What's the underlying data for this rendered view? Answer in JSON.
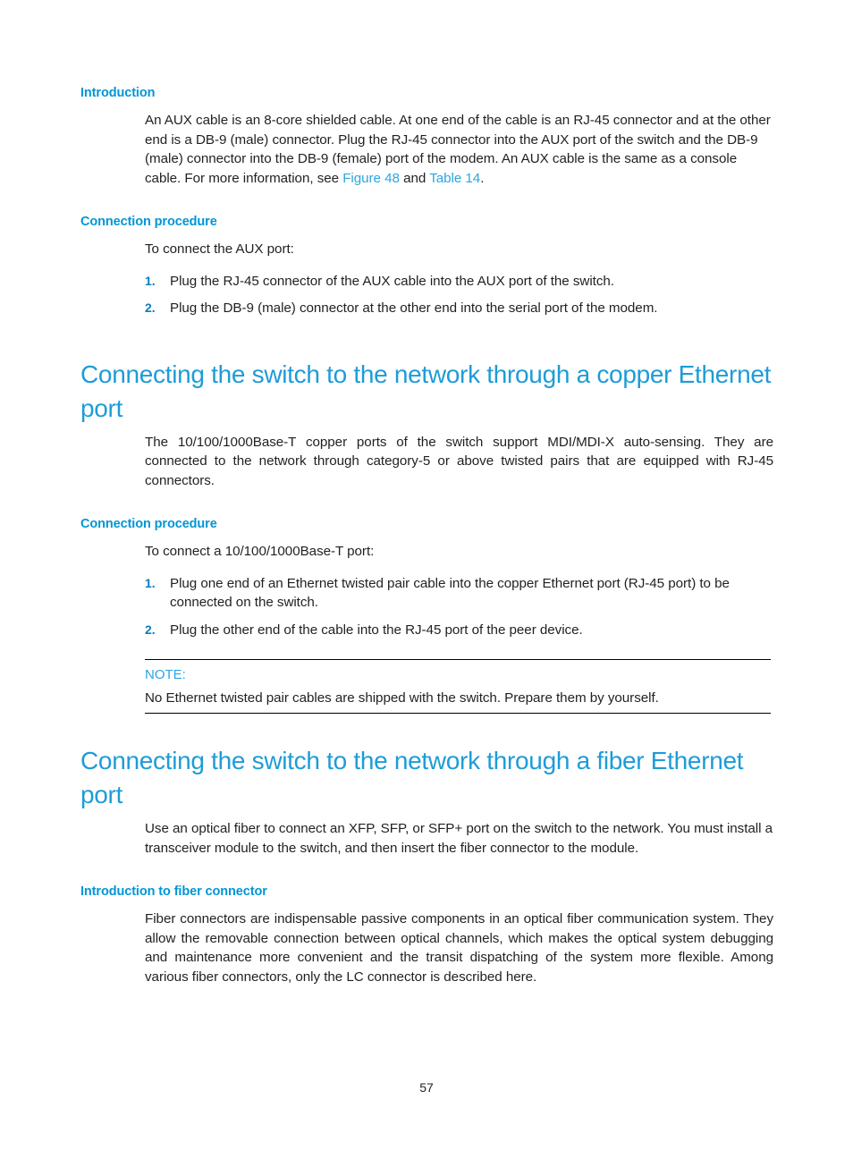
{
  "page": {
    "number": "57",
    "accent_heading_color": "#0096d6",
    "accent_title_color": "#1d9cd8",
    "link_color": "#2ba6de",
    "list_marker_color": "#0b7bbd",
    "body_text_color": "#231f20"
  },
  "sections": {
    "introduction_aux": {
      "heading": "Introduction",
      "paragraph_before_links": "An AUX cable is an 8-core shielded cable. At one end of the cable is an RJ-45 connector and at the other end is a DB-9 (male) connector. Plug the RJ-45 connector into the AUX port of the switch and the DB-9 (male) connector into the DB-9 (female) port of the modem. An AUX cable is the same as a console cable. For more information, see ",
      "link_figure": "Figure 48",
      "between_links": " and ",
      "link_table": "Table 14",
      "paragraph_after_links": "."
    },
    "connection_procedure_aux": {
      "heading": "Connection procedure",
      "intro": "To connect the AUX port:",
      "steps": [
        {
          "marker": "1.",
          "text": "Plug the RJ-45 connector of the AUX cable into the AUX port of the switch."
        },
        {
          "marker": "2.",
          "text": "Plug the DB-9 (male) connector at the other end into the serial port of the modem."
        }
      ]
    },
    "copper_ethernet": {
      "title": "Connecting the switch to the network through a copper Ethernet port",
      "paragraph": "The 10/100/1000Base-T copper ports of the switch support MDI/MDI-X auto-sensing. They are connected to the network through category-5 or above twisted pairs that are equipped with RJ-45 connectors."
    },
    "connection_procedure_copper": {
      "heading": "Connection procedure",
      "intro": "To connect a 10/100/1000Base-T port:",
      "steps": [
        {
          "marker": "1.",
          "text": "Plug one end of an Ethernet twisted pair cable into the copper Ethernet port (RJ-45 port) to be connected on the switch."
        },
        {
          "marker": "2.",
          "text": "Plug the other end of the cable into the RJ-45 port of the peer device."
        }
      ],
      "note": {
        "label": "NOTE:",
        "text": "No Ethernet twisted pair cables are shipped with the switch. Prepare them by yourself."
      }
    },
    "fiber_ethernet": {
      "title": "Connecting the switch to the network through a fiber Ethernet port",
      "paragraph": "Use an optical fiber to connect an XFP, SFP, or SFP+ port on the switch to the network. You must install a transceiver module to the switch, and then insert the fiber connector to the module."
    },
    "introduction_fiber": {
      "heading": "Introduction to fiber connector",
      "paragraph": "Fiber connectors are indispensable passive components in an optical fiber communication system. They allow the removable connection between optical channels, which makes the optical system debugging and maintenance more convenient and the transit dispatching of the system more flexible. Among various fiber connectors, only the LC connector is described here."
    }
  }
}
